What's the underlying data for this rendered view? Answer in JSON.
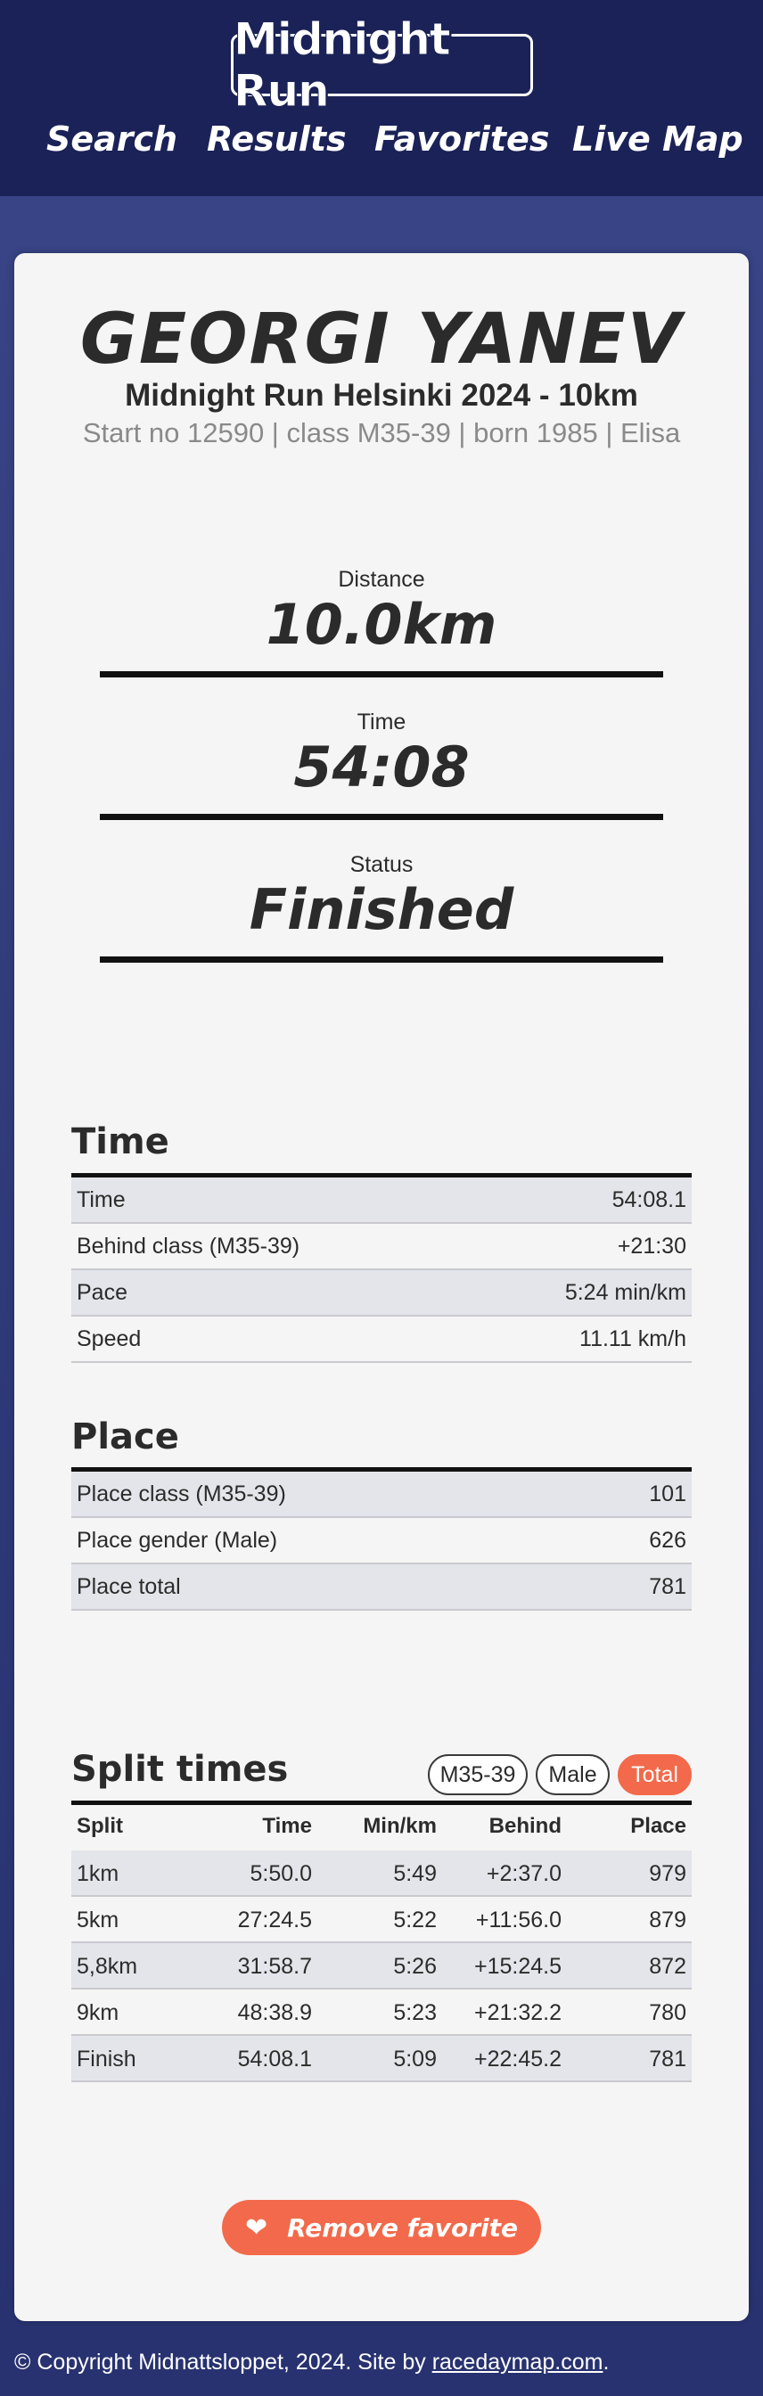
{
  "header": {
    "logo": "Midnight Run",
    "nav": [
      "Search",
      "Results",
      "Favorites",
      "Live Map"
    ]
  },
  "runner": {
    "name": "GEORGI YANEV",
    "race": "Midnight Run Helsinki 2024 - 10km",
    "meta": "Start no 12590 | class M35-39 | born 1985 | Elisa"
  },
  "summary": [
    {
      "label": "Distance",
      "value": "10.0km"
    },
    {
      "label": "Time",
      "value": "54:08"
    },
    {
      "label": "Status",
      "value": "Finished"
    }
  ],
  "time_section": {
    "title": "Time",
    "rows": [
      {
        "k": "Time",
        "v": "54:08.1"
      },
      {
        "k": "Behind class (M35-39)",
        "v": "+21:30"
      },
      {
        "k": "Pace",
        "v": "5:24 min/km"
      },
      {
        "k": "Speed",
        "v": "11.11 km/h"
      }
    ]
  },
  "place_section": {
    "title": "Place",
    "rows": [
      {
        "k": "Place class (M35-39)",
        "v": "101"
      },
      {
        "k": "Place gender (Male)",
        "v": "626"
      },
      {
        "k": "Place total",
        "v": "781"
      }
    ]
  },
  "splits": {
    "title": "Split times",
    "filters": [
      {
        "label": "M35-39",
        "active": false
      },
      {
        "label": "Male",
        "active": false
      },
      {
        "label": "Total",
        "active": true
      }
    ],
    "columns": [
      "Split",
      "Time",
      "Min/km",
      "Behind",
      "Place"
    ],
    "rows": [
      [
        "1km",
        "5:50.0",
        "5:49",
        "+2:37.0",
        "979"
      ],
      [
        "5km",
        "27:24.5",
        "5:22",
        "+11:56.0",
        "879"
      ],
      [
        "5,8km",
        "31:58.7",
        "5:26",
        "+15:24.5",
        "872"
      ],
      [
        "9km",
        "48:38.9",
        "5:23",
        "+21:32.2",
        "780"
      ],
      [
        "Finish",
        "54:08.1",
        "5:09",
        "+22:45.2",
        "781"
      ]
    ]
  },
  "favorite_button": {
    "label": "Remove favorite",
    "icon": "heart-icon"
  },
  "footer": {
    "text": "© Copyright Midnattsloppet, 2024. Site by ",
    "link": "racedaymap.com",
    "end": "."
  },
  "colors": {
    "accent": "#f26a4b",
    "header_bg": "#1b2257",
    "page_bg": "#2f3a7a"
  }
}
